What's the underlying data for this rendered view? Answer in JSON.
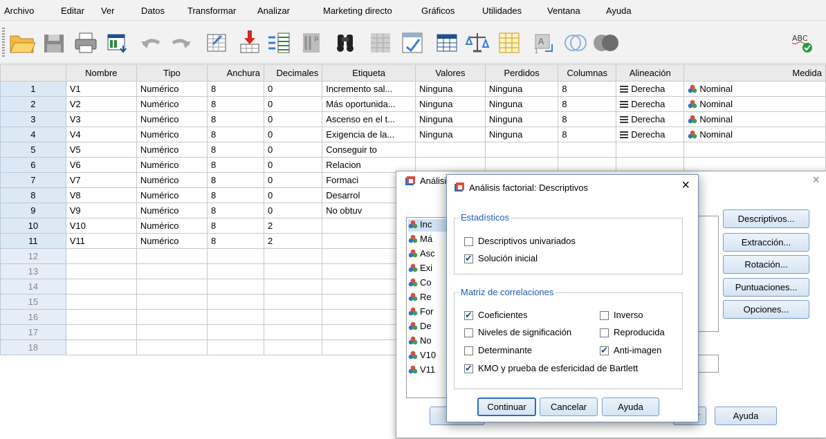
{
  "menu": [
    "Archivo",
    "Editar",
    "Ver",
    "Datos",
    "Transformar",
    "Analizar",
    "Marketing directo",
    "Gráficos",
    "Utilidades",
    "Ventana",
    "Ayuda"
  ],
  "toolbar": [
    "open-icon",
    "save-icon",
    "print-icon",
    "recall-dialog-icon",
    "undo-icon",
    "redo-icon",
    "goto-case-icon",
    "goto-variable-icon",
    "variables-icon",
    "run-descriptives-icon",
    "find-icon",
    "insert-cases-icon",
    "insert-variable-icon",
    "split-file-icon",
    "weight-cases-icon",
    "select-cases-icon",
    "value-labels-icon",
    "use-sets-icon",
    "show-all-variables-icon",
    "spell-check-icon"
  ],
  "columns": [
    "Nombre",
    "Tipo",
    "Anchura",
    "Decimales",
    "Etiqueta",
    "Valores",
    "Perdidos",
    "Columnas",
    "Alineación",
    "Medida"
  ],
  "rows": [
    {
      "n": "1",
      "nombre": "V1",
      "tipo": "Numérico",
      "anchura": "8",
      "decimales": "0",
      "etiqueta": "Incremento sal...",
      "valores": "Ninguna",
      "perdidos": "Ninguna",
      "columnas": "8",
      "alineacion": "Derecha",
      "medida": "Nominal"
    },
    {
      "n": "2",
      "nombre": "V2",
      "tipo": "Numérico",
      "anchura": "8",
      "decimales": "0",
      "etiqueta": "Más oportunida...",
      "valores": "Ninguna",
      "perdidos": "Ninguna",
      "columnas": "8",
      "alineacion": "Derecha",
      "medida": "Nominal"
    },
    {
      "n": "3",
      "nombre": "V3",
      "tipo": "Numérico",
      "anchura": "8",
      "decimales": "0",
      "etiqueta": "Ascenso en el t...",
      "valores": "Ninguna",
      "perdidos": "Ninguna",
      "columnas": "8",
      "alineacion": "Derecha",
      "medida": "Nominal"
    },
    {
      "n": "4",
      "nombre": "V4",
      "tipo": "Numérico",
      "anchura": "8",
      "decimales": "0",
      "etiqueta": "Exigencia de la...",
      "valores": "Ninguna",
      "perdidos": "Ninguna",
      "columnas": "8",
      "alineacion": "Derecha",
      "medida": "Nominal"
    },
    {
      "n": "5",
      "nombre": "V5",
      "tipo": "Numérico",
      "anchura": "8",
      "decimales": "0",
      "etiqueta": "Conseguir to",
      "valores": "",
      "perdidos": "",
      "columnas": "",
      "alineacion": "",
      "medida": ""
    },
    {
      "n": "6",
      "nombre": "V6",
      "tipo": "Numérico",
      "anchura": "8",
      "decimales": "0",
      "etiqueta": "Relacion",
      "valores": "",
      "perdidos": "",
      "columnas": "",
      "alineacion": "",
      "medida": ""
    },
    {
      "n": "7",
      "nombre": "V7",
      "tipo": "Numérico",
      "anchura": "8",
      "decimales": "0",
      "etiqueta": "Formaci",
      "valores": "",
      "perdidos": "",
      "columnas": "",
      "alineacion": "",
      "medida": ""
    },
    {
      "n": "8",
      "nombre": "V8",
      "tipo": "Numérico",
      "anchura": "8",
      "decimales": "0",
      "etiqueta": "Desarrol",
      "valores": "",
      "perdidos": "",
      "columnas": "",
      "alineacion": "",
      "medida": ""
    },
    {
      "n": "9",
      "nombre": "V9",
      "tipo": "Numérico",
      "anchura": "8",
      "decimales": "0",
      "etiqueta": "No obtuv",
      "valores": "",
      "perdidos": "",
      "columnas": "",
      "alineacion": "",
      "medida": ""
    },
    {
      "n": "10",
      "nombre": "V10",
      "tipo": "Numérico",
      "anchura": "8",
      "decimales": "2",
      "etiqueta": "",
      "valores": "",
      "perdidos": "",
      "columnas": "",
      "alineacion": "",
      "medida": ""
    },
    {
      "n": "11",
      "nombre": "V11",
      "tipo": "Numérico",
      "anchura": "8",
      "decimales": "2",
      "etiqueta": "",
      "valores": "",
      "perdidos": "",
      "columnas": "",
      "alineacion": "",
      "medida": ""
    }
  ],
  "empty_rows": [
    "12",
    "13",
    "14",
    "15",
    "16",
    "17",
    "18"
  ],
  "bg_dialog": {
    "title": "Análisis factorial",
    "variables": [
      "Inc",
      "Má",
      "Asc",
      "Exi",
      "Co",
      "Re",
      "For",
      "De",
      "No",
      "V10",
      "V11"
    ],
    "buttons": [
      "Descriptivos...",
      "Extracción...",
      "Rotación...",
      "Puntuaciones...",
      "Opciones..."
    ],
    "bottom_buttons": [
      "ar",
      "Ayuda"
    ]
  },
  "dialog": {
    "title": "Análisis factorial: Descriptivos",
    "close": "×",
    "group1": "Estadísticos",
    "opt_univariados": "Descriptivos univariados",
    "opt_solucion": "Solución inicial",
    "group2": "Matriz de correlaciones",
    "opt_coeficientes": "Coeficientes",
    "opt_inverso": "Inverso",
    "opt_niveles": "Niveles de significación",
    "opt_reproducida": "Reproducida",
    "opt_determinante": "Determinante",
    "opt_antiimagen": "Anti-imagen",
    "opt_kmo": "KMO y prueba de esfericidad de Bartlett",
    "btn_continuar": "Continuar",
    "btn_cancelar": "Cancelar",
    "btn_ayuda": "Ayuda",
    "checked": {
      "univariados": false,
      "solucion": true,
      "coeficientes": true,
      "inverso": false,
      "niveles": false,
      "reproducida": false,
      "determinante": false,
      "antiimagen": true,
      "kmo": true
    }
  },
  "colors": {
    "accent": "#1a5cb8",
    "row_header": "#dde8f5",
    "button_border": "#7a9cc7"
  }
}
